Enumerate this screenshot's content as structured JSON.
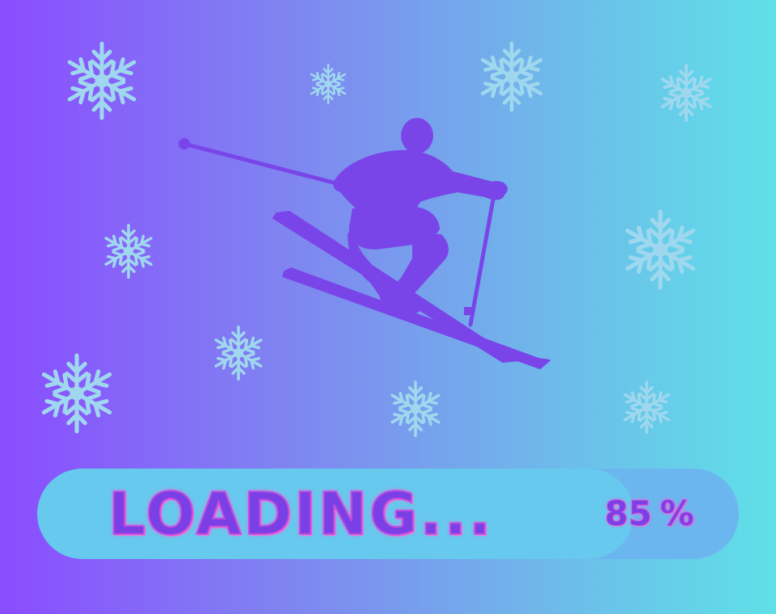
{
  "loading": {
    "label": "LOADING...",
    "progress_value": "85",
    "progress_unit": "%",
    "progress_fraction": 0.85
  },
  "icons": {
    "snowflake": "snowflake-icon",
    "skier": "skier-icon"
  },
  "colors": {
    "gradient_start": "#8a4cff",
    "gradient_end": "#5fe0e8",
    "skier": "#7a45e8",
    "snowflake": "#9fd8ee",
    "bar_track": "#6cb6ef",
    "bar_fill": "#67c9ee",
    "text": "#7b3fe6",
    "text_glow": "#ff5fd4"
  }
}
